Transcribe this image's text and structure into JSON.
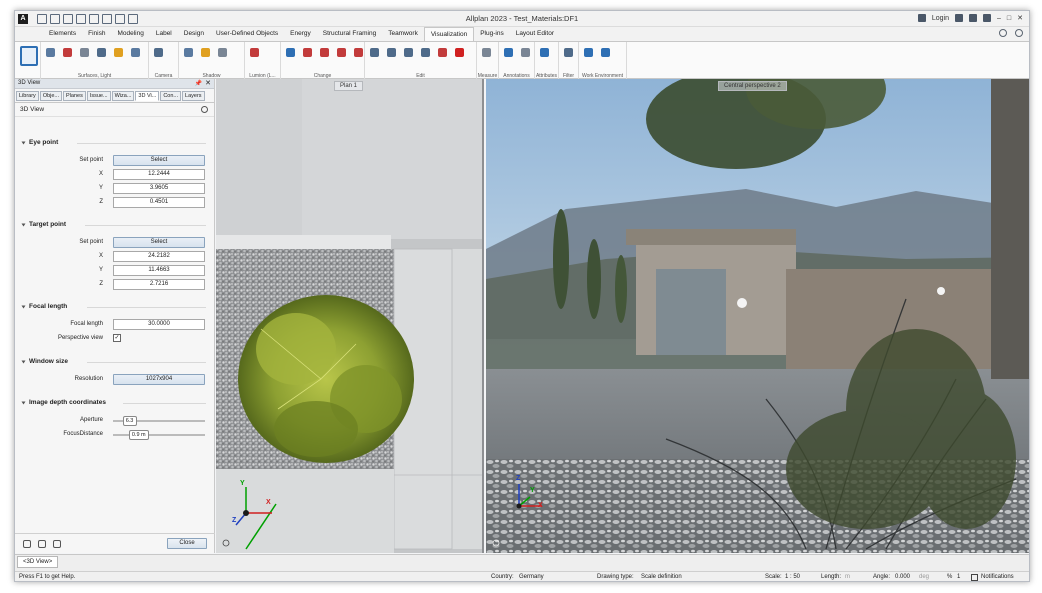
{
  "app": {
    "logo_letter": "A",
    "title": "Allplan 2023 - Test_Materials:DF1",
    "login_label": "Login"
  },
  "ribbon_tabs": [
    "Elements",
    "Finish",
    "Modeling",
    "Label",
    "Design",
    "User-Defined Objects",
    "Energy",
    "Structural Framing",
    "Teamwork",
    "Visualization",
    "Plug-ins",
    "Layout Editor"
  ],
  "ribbon_groups": {
    "surfaces_light": "Surfaces, Light",
    "camera": "Camera",
    "shadow": "Shadow",
    "lumion": "Lumion (L...",
    "change": "Change",
    "edit": "Edit",
    "measure": "Measure",
    "annotations": "Annotations",
    "attributes": "Attributes",
    "filter": "Filter",
    "work_environment": "Work Environment"
  },
  "panel": {
    "title": "3D View",
    "tabs": [
      "Library",
      "Obje...",
      "Planes",
      "Issue...",
      "Wiza...",
      "3D Vi...",
      "Con...",
      "Layers"
    ],
    "subheading": "3D View",
    "eye_point": {
      "title": "Eye point",
      "set_point_label": "Set point",
      "select_label": "Select",
      "x_label": "X",
      "x": "12.2444",
      "y_label": "Y",
      "y": "3.9605",
      "z_label": "Z",
      "z": "0.4501"
    },
    "target_point": {
      "title": "Target point",
      "set_point_label": "Set point",
      "select_label": "Select",
      "x_label": "X",
      "x": "24.2182",
      "y_label": "Y",
      "y": "11.4663",
      "z_label": "Z",
      "z": "2.7216"
    },
    "focal": {
      "title": "Focal length",
      "focal_label": "Focal length",
      "focal_value": "30.0000",
      "perspective_label": "Perspective view",
      "perspective_checked": "✓"
    },
    "window_size": {
      "title": "Window size",
      "resolution_label": "Resolution",
      "resolution_value": "1027x904"
    },
    "depth": {
      "title": "Image depth coordinates",
      "aperture_label": "Aperture",
      "aperture_value": "6.3",
      "aperture_level": 0.18,
      "focus_label": "FocusDistance",
      "focus_value": "0.9 m",
      "focus_level": 0.28
    },
    "close_label": "Close"
  },
  "viewports": {
    "plan_label": "Plan 1",
    "persp_label": "Central perspective 2",
    "axis_x": "X",
    "axis_y": "Y",
    "axis_z": "Z"
  },
  "document_tab": "<3D View>",
  "status": {
    "help": "Press F1 to get Help.",
    "country_label": "Country:",
    "country": "Germany",
    "drawing_type_label": "Drawing type:",
    "drawing_type": "Scale definition",
    "scale_label": "Scale:",
    "scale": "1 : 50",
    "length_label": "Length:",
    "length_unit": "m",
    "angle_label": "Angle:",
    "angle": "0.000",
    "angle_unit": "deg",
    "percent_label": "%",
    "percent": "1",
    "notifications": "Notifications"
  }
}
